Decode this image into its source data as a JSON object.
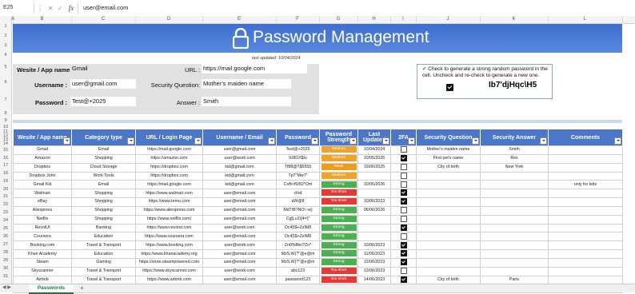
{
  "formula_bar": {
    "cell_ref": "E25",
    "fx_label": "fx",
    "content": "user@email.com"
  },
  "columns": [
    "A",
    "B",
    "C",
    "D",
    "E",
    "F",
    "G",
    "H",
    "I",
    "J",
    "K",
    "L"
  ],
  "rows": [
    "1",
    "2",
    "3",
    "4",
    "5",
    "6",
    "7",
    "8",
    "9",
    "10",
    "11",
    "12",
    "13",
    "14",
    "15",
    "16",
    "17",
    "18",
    "19",
    "20",
    "21",
    "22",
    "23",
    "24",
    "25",
    "26",
    "27",
    "28",
    "29",
    "30",
    "31"
  ],
  "title": "Password Management",
  "last_updated": "last updated: 10/04/2024",
  "form": {
    "website_label": "Wesite / App name :",
    "website_value": "Gmail",
    "url_label": "URL :",
    "url_value": "https://mail.google.com",
    "username_label": "Username :",
    "username_value": "user@gmail.com",
    "question_label": "Security Question:",
    "question_value": "Mother's maiden name",
    "password_label": "Password :",
    "password_value": "Test@+2025",
    "answer_label": "Answer :",
    "answer_value": "Smith"
  },
  "generator": {
    "text": "✓ Check to generate a strong random password in the cell. Uncheck and re-check to generate a new one.",
    "password": "Ib7'djHqc\\H5"
  },
  "table": {
    "headers": [
      "Wesite / App name",
      "Category type",
      "URL / Login Page",
      "Username / Email",
      "Password",
      "Password Strength",
      "Last Updated",
      "2FA",
      "Security Question",
      "Security Answer",
      "Comments"
    ],
    "rows": [
      [
        "Gmail",
        "Email",
        "https://mail.google.com",
        "user@gmail.com",
        "Test@+2025",
        "Medium",
        "10/04/2024",
        false,
        "Mother's maiden name",
        "Smith",
        ""
      ],
      [
        "Amazon",
        "Shopping",
        "https://amazon.com",
        "user@work.com",
        "IU8O/\\$Iu",
        "Medium",
        "10/05/2026",
        true,
        "First pet's name",
        "Rex",
        ""
      ],
      [
        "Dropbox",
        "Cloud Storage",
        "https://dropbox.com",
        "kid@gmail.com",
        "T8f8@!\\$5555",
        "Weak",
        "10/06/2025",
        false,
        "City of birth",
        "New York",
        ""
      ],
      [
        "Dropbox John",
        "Work Tools",
        "https://dropbox.com",
        "kid@gmail.com",
        "Tp7\"Mw?\"",
        "Medium",
        "",
        false,
        "",
        "",
        ""
      ],
      [
        "Gmail Kid",
        "Email",
        "https://mail.google.com",
        "kid@gmail.com",
        "CnB<f0/82*Om",
        "Strong",
        "10/05/2026",
        false,
        "",
        "",
        "only for kids"
      ],
      [
        "Walmart",
        "Shopping",
        "https://www.walmart.com",
        "user@email.com",
        "cfod",
        "Too short",
        "",
        true,
        "",
        "",
        ""
      ],
      [
        "eBay",
        "Shopping",
        "https://www.temu.com",
        "user@email.com",
        "aW@8",
        "Too short",
        "10/06/2023",
        true,
        "",
        "",
        ""
      ],
      [
        "Aliexpress",
        "Shopping",
        "https://www.aliexpress.com",
        "user@email.com",
        "Md7/B?NO\\~w)",
        "Strong",
        "06/06/2026",
        false,
        "",
        "",
        ""
      ],
      [
        "Netflix",
        "Shopping",
        "https://www.netflix.com/",
        "user@email.com",
        "Cg[Lu1\\[4=)\"",
        "Strong",
        "",
        false,
        "",
        "",
        ""
      ],
      [
        "RevolUt",
        "Banking",
        "https://www.revolut.com",
        "user@work.com",
        "Oc4[\\$+ZzIM8",
        "Strong",
        "",
        true,
        "",
        "",
        ""
      ],
      [
        "Coursera",
        "Education",
        "https://www.coursera.com",
        "user@email.com",
        "Oc4[\\$+ZzIM8",
        "Strong",
        "",
        false,
        "",
        "",
        ""
      ],
      [
        "Booking.com",
        "Travel & Transport",
        "https://www.booking.com",
        "user@work.com",
        "Zn0%8kn?Zn*",
        "Strong",
        "10/06/2023",
        true,
        "",
        "",
        ""
      ],
      [
        "Khan Academy",
        "Education",
        "https://www.khanacademy.org",
        "user@email.com",
        "MzS.W(?\"@e@m",
        "Strong",
        "11/06/2023",
        true,
        "",
        "",
        ""
      ],
      [
        "Steam",
        "Gaming",
        "https://store.steampowered.com",
        "user@email.com",
        "MzS.W(?\"@e@m",
        "Strong",
        "12/06/2023",
        true,
        "",
        "",
        ""
      ],
      [
        "Skyscanner",
        "Travel & Transport",
        "https://www.skyscanner.com",
        "user@work.com",
        "abc123",
        "Too short",
        "13/06/2023",
        false,
        "",
        "",
        ""
      ],
      [
        "Airbnb",
        "Travel & Transport",
        "https://www.airbnb.com",
        "user@email.com",
        "password123",
        "Too short",
        "14/06/2023",
        true,
        "City of birth",
        "Paris",
        ""
      ],
      [
        "Shopify",
        "Work Tools",
        "https://www.shopify.com",
        "user@work.com",
        "123qwe",
        "Too short",
        "15/06/2023",
        true,
        "",
        "",
        ""
      ]
    ]
  },
  "strength_colors": {
    "Strong": "#4caf50",
    "Medium": "#f0a22e",
    "Weak": "#f39c12",
    "Too short": "#e53935"
  },
  "sheet_tab": "Passwords",
  "tab_add": "+"
}
